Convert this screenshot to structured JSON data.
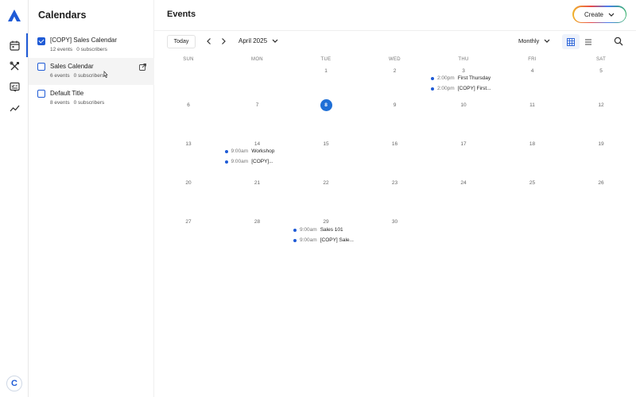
{
  "calendars_panel": {
    "title": "Calendars",
    "items": [
      {
        "name": "[COPY] Sales Calendar",
        "events": "12 events",
        "subscribers": "0 subscribers",
        "checked": true
      },
      {
        "name": "Sales Calendar",
        "events": "6 events",
        "subscribers": "0 subscribers",
        "checked": false
      },
      {
        "name": "Default Title",
        "events": "8 events",
        "subscribers": "0 subscribers",
        "checked": false
      }
    ]
  },
  "rail": {
    "avatar_letter": "C"
  },
  "header": {
    "title": "Events",
    "create_label": "Create"
  },
  "toolbar": {
    "today_label": "Today",
    "month_label": "April 2025",
    "view_label": "Monthly"
  },
  "calendar": {
    "weekdays": [
      "SUN",
      "MON",
      "TUE",
      "WED",
      "THU",
      "FRI",
      "SAT"
    ],
    "weeks": [
      [
        "",
        "",
        "1",
        "2",
        "3",
        "4",
        "5"
      ],
      [
        "6",
        "7",
        "8",
        "9",
        "10",
        "11",
        "12"
      ],
      [
        "13",
        "14",
        "15",
        "16",
        "17",
        "18",
        "19"
      ],
      [
        "20",
        "21",
        "22",
        "23",
        "24",
        "25",
        "26"
      ],
      [
        "27",
        "28",
        "29",
        "30",
        "",
        "",
        ""
      ]
    ],
    "today": "8",
    "events": [
      {
        "time": "2:00pm",
        "title": "First Thursday"
      },
      {
        "time": "2:00pm",
        "title": "[COPY] First..."
      },
      {
        "time": "9:00am",
        "title": "Workshop"
      },
      {
        "time": "9:00am",
        "title": "[COPY]..."
      },
      {
        "time": "9:00am",
        "title": "Sales 101"
      },
      {
        "time": "9:00am",
        "title": "[COPY] Sale..."
      }
    ]
  },
  "colors": {
    "accent": "#1f5bd6",
    "today": "#1f6fd6"
  }
}
